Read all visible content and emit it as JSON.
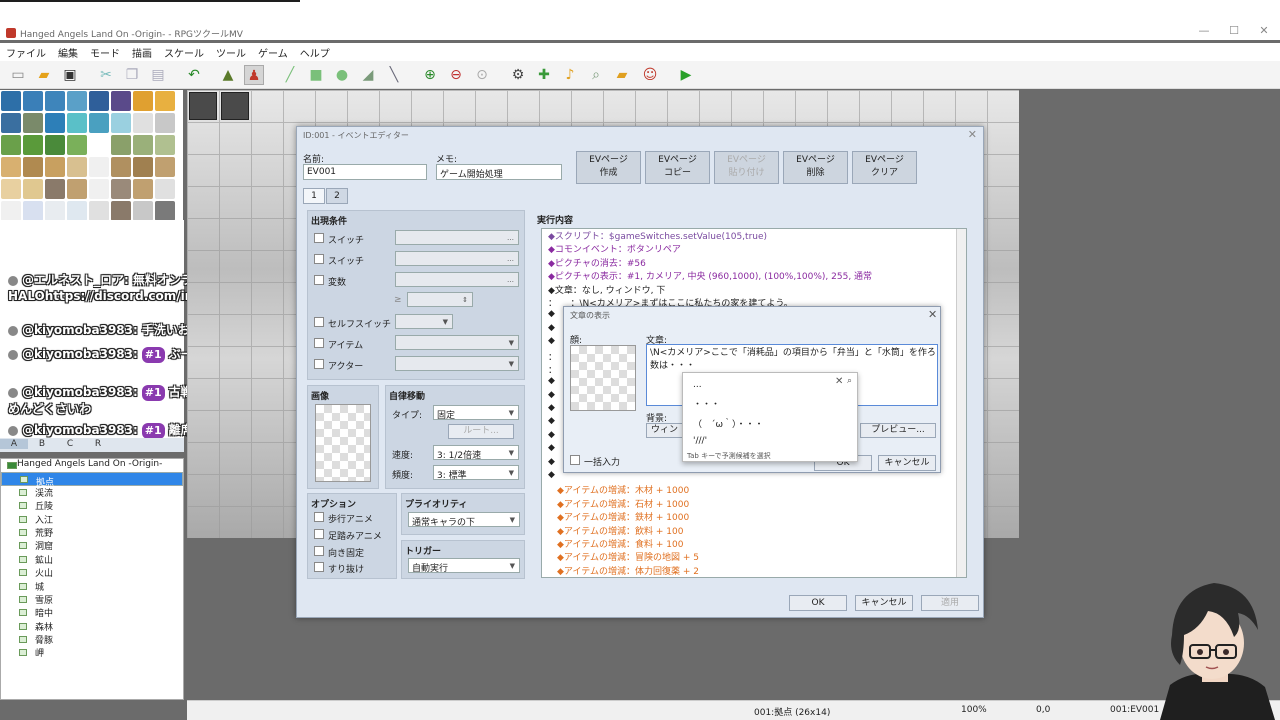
{
  "window": {
    "title": "Hanged Angels Land On -Origin- - RPGツクールMV",
    "controls": [
      "—",
      "☐",
      "✕"
    ]
  },
  "menu": [
    "ファイル",
    "編集",
    "モード",
    "描画",
    "スケール",
    "ツール",
    "ゲーム",
    "ヘルプ"
  ],
  "toolbar": {
    "icons": [
      "new-project-icon",
      "open-project-icon",
      "save-project-icon",
      "cut-icon",
      "copy-icon",
      "paste-icon",
      "undo-icon",
      "map-mode-icon",
      "event-mode-icon",
      "pencil-icon",
      "rectangle-icon",
      "ellipse-icon",
      "fill-icon",
      "shadow-pen-icon",
      "zoom-in-icon",
      "zoom-out-icon",
      "actual-size-icon",
      "database-icon",
      "plugin-manager-icon",
      "sound-test-icon",
      "event-searcher-icon",
      "resource-manager-icon",
      "character-generator-icon",
      "playtest-icon"
    ]
  },
  "chat": [
    {
      "user": "@エルネスト_ロア:",
      "badge": "",
      "text": "無料オンラインカードゲームHALOhttps://discord.com/invite/NDGsuhcVaX"
    },
    {
      "user": "@kiyomoba3983:",
      "badge": "",
      "text": "手洗いおかえり"
    },
    {
      "user": "@kiyomoba3983:",
      "badge": "#1",
      "text": "ぶー配送準備でけた"
    },
    {
      "user": "@kiyomoba3983:",
      "badge": "#1",
      "text": "古戦場関に挟まってるとめんどくさいわ"
    },
    {
      "user": "@kiyomoba3983:",
      "badge": "#1",
      "text": "離席中w"
    }
  ],
  "tileset_tabs": [
    "A",
    "B",
    "C",
    "R"
  ],
  "map_tree": {
    "root": "Hanged Angels Land On -Origin-",
    "items": [
      "拠点",
      "渓流",
      "丘陵",
      "入江",
      "荒野",
      "洞窟",
      "鉱山",
      "火山",
      "城",
      "雪原",
      "暗中",
      "森林",
      "脅豚",
      "岬"
    ],
    "selected_index": 0
  },
  "status": {
    "zoom": "100%",
    "coords": "0,0",
    "map": "001:拠点 (26x14)",
    "event": "001:EV001"
  },
  "editor": {
    "title": "ID:001 - イベントエディター",
    "name_label": "名前:",
    "name_value": "EV001",
    "memo_label": "メモ:",
    "memo_value": "ゲーム開始処理",
    "page_buttons": [
      "EVページ\n作成",
      "EVページ\nコピー",
      "EVページ\n貼り付け",
      "EVページ\n削除",
      "EVページ\nクリア"
    ],
    "tabs": [
      "1",
      "2"
    ],
    "conditions_title": "出現条件",
    "conditions": [
      "スイッチ",
      "スイッチ",
      "変数",
      "セルフスイッチ",
      "アイテム",
      "アクター"
    ],
    "variable_op": "≥",
    "image_title": "画像",
    "autonomous_title": "自律移動",
    "type_label": "タイプ:",
    "type_value": "固定",
    "route_button": "ルート...",
    "speed_label": "速度:",
    "speed_value": "3: 1/2倍速",
    "freq_label": "頻度:",
    "freq_value": "3: 標準",
    "options_title": "オプション",
    "options": [
      "歩行アニメ",
      "足踏みアニメ",
      "向き固定",
      "すり抜け"
    ],
    "priority_title": "プライオリティ",
    "priority_value": "通常キャラの下",
    "trigger_title": "トリガー",
    "trigger_value": "自動実行",
    "contents_title": "実行内容",
    "contents": [
      {
        "text": "◆スクリプト：$gameSwitches.setValue(105,true)",
        "color": "#7a4aa0"
      },
      {
        "text": "◆コモンイベント：ボタンリペア",
        "color": "#8a2aa0"
      },
      {
        "text": "◆ピクチャの消去：#56",
        "color": "#8a2aa0"
      },
      {
        "text": "◆ピクチャの表示：#1, カメリア, 中央 (960,1000), (100%,100%), 255, 通常",
        "color": "#8a2aa0"
      },
      {
        "text": "◆文章：なし, ウィンドウ, 下",
        "color": "#222"
      },
      {
        "text": "：　　：\\N<カメリア>まずはここに私たちの家を建てよう。",
        "color": "#222"
      },
      {
        "text": "◆",
        "color": "#222"
      },
      {
        "text": "◆",
        "color": "#222"
      },
      {
        "text": "◆",
        "color": "#222"
      },
      {
        "text": "：",
        "color": "#222"
      },
      {
        "text": "：",
        "color": "#222"
      },
      {
        "text": "◆",
        "color": "#222"
      },
      {
        "text": "◆",
        "color": "#222"
      },
      {
        "text": "◆",
        "color": "#222"
      },
      {
        "text": "◆",
        "color": "#222"
      },
      {
        "text": "◆",
        "color": "#222"
      },
      {
        "text": "◆",
        "color": "#222"
      },
      {
        "text": "◆",
        "color": "#222"
      },
      {
        "text": "◆",
        "color": "#222"
      },
      {
        "text": "　◆アイテムの増減：木材 + 1000",
        "color": "#e07020"
      },
      {
        "text": "　◆アイテムの増減：石材 + 1000",
        "color": "#e07020"
      },
      {
        "text": "　◆アイテムの増減：鉄材 + 1000",
        "color": "#e07020"
      },
      {
        "text": "　◆アイテムの増減：飲料 + 100",
        "color": "#e07020"
      },
      {
        "text": "　◆アイテムの増減：食料 + 100",
        "color": "#e07020"
      },
      {
        "text": "　◆アイテムの増減：冒険の地図 + 5",
        "color": "#e07020"
      },
      {
        "text": "　◆アイテムの増減：体力回復薬 + 2",
        "color": "#e07020"
      }
    ],
    "ok": "OK",
    "cancel": "キャンセル",
    "apply": "適用"
  },
  "text_dialog": {
    "title": "文章の表示",
    "face_label": "顔:",
    "text_label": "文章:",
    "text_line1": "\\N<カメリア>ここで「消耗品」の項目から「弁当」と「水筒」を作ろう",
    "text_line2": "数は・・・",
    "background_label": "背景:",
    "background_value": "ウィン",
    "batch_label": "一括入力",
    "preview": "プレビュー...",
    "ok": "OK",
    "cancel": "キャンセル"
  },
  "ime": {
    "candidates": [
      "...",
      "・・・",
      "（　´ω｀）・・・",
      "'///'"
    ],
    "hint": "Tab キーで予測候補を選択"
  },
  "colors": {
    "accent": "#2f86e8",
    "editor_bg": "#dfe7f2",
    "badge": "#8a3aaf"
  }
}
